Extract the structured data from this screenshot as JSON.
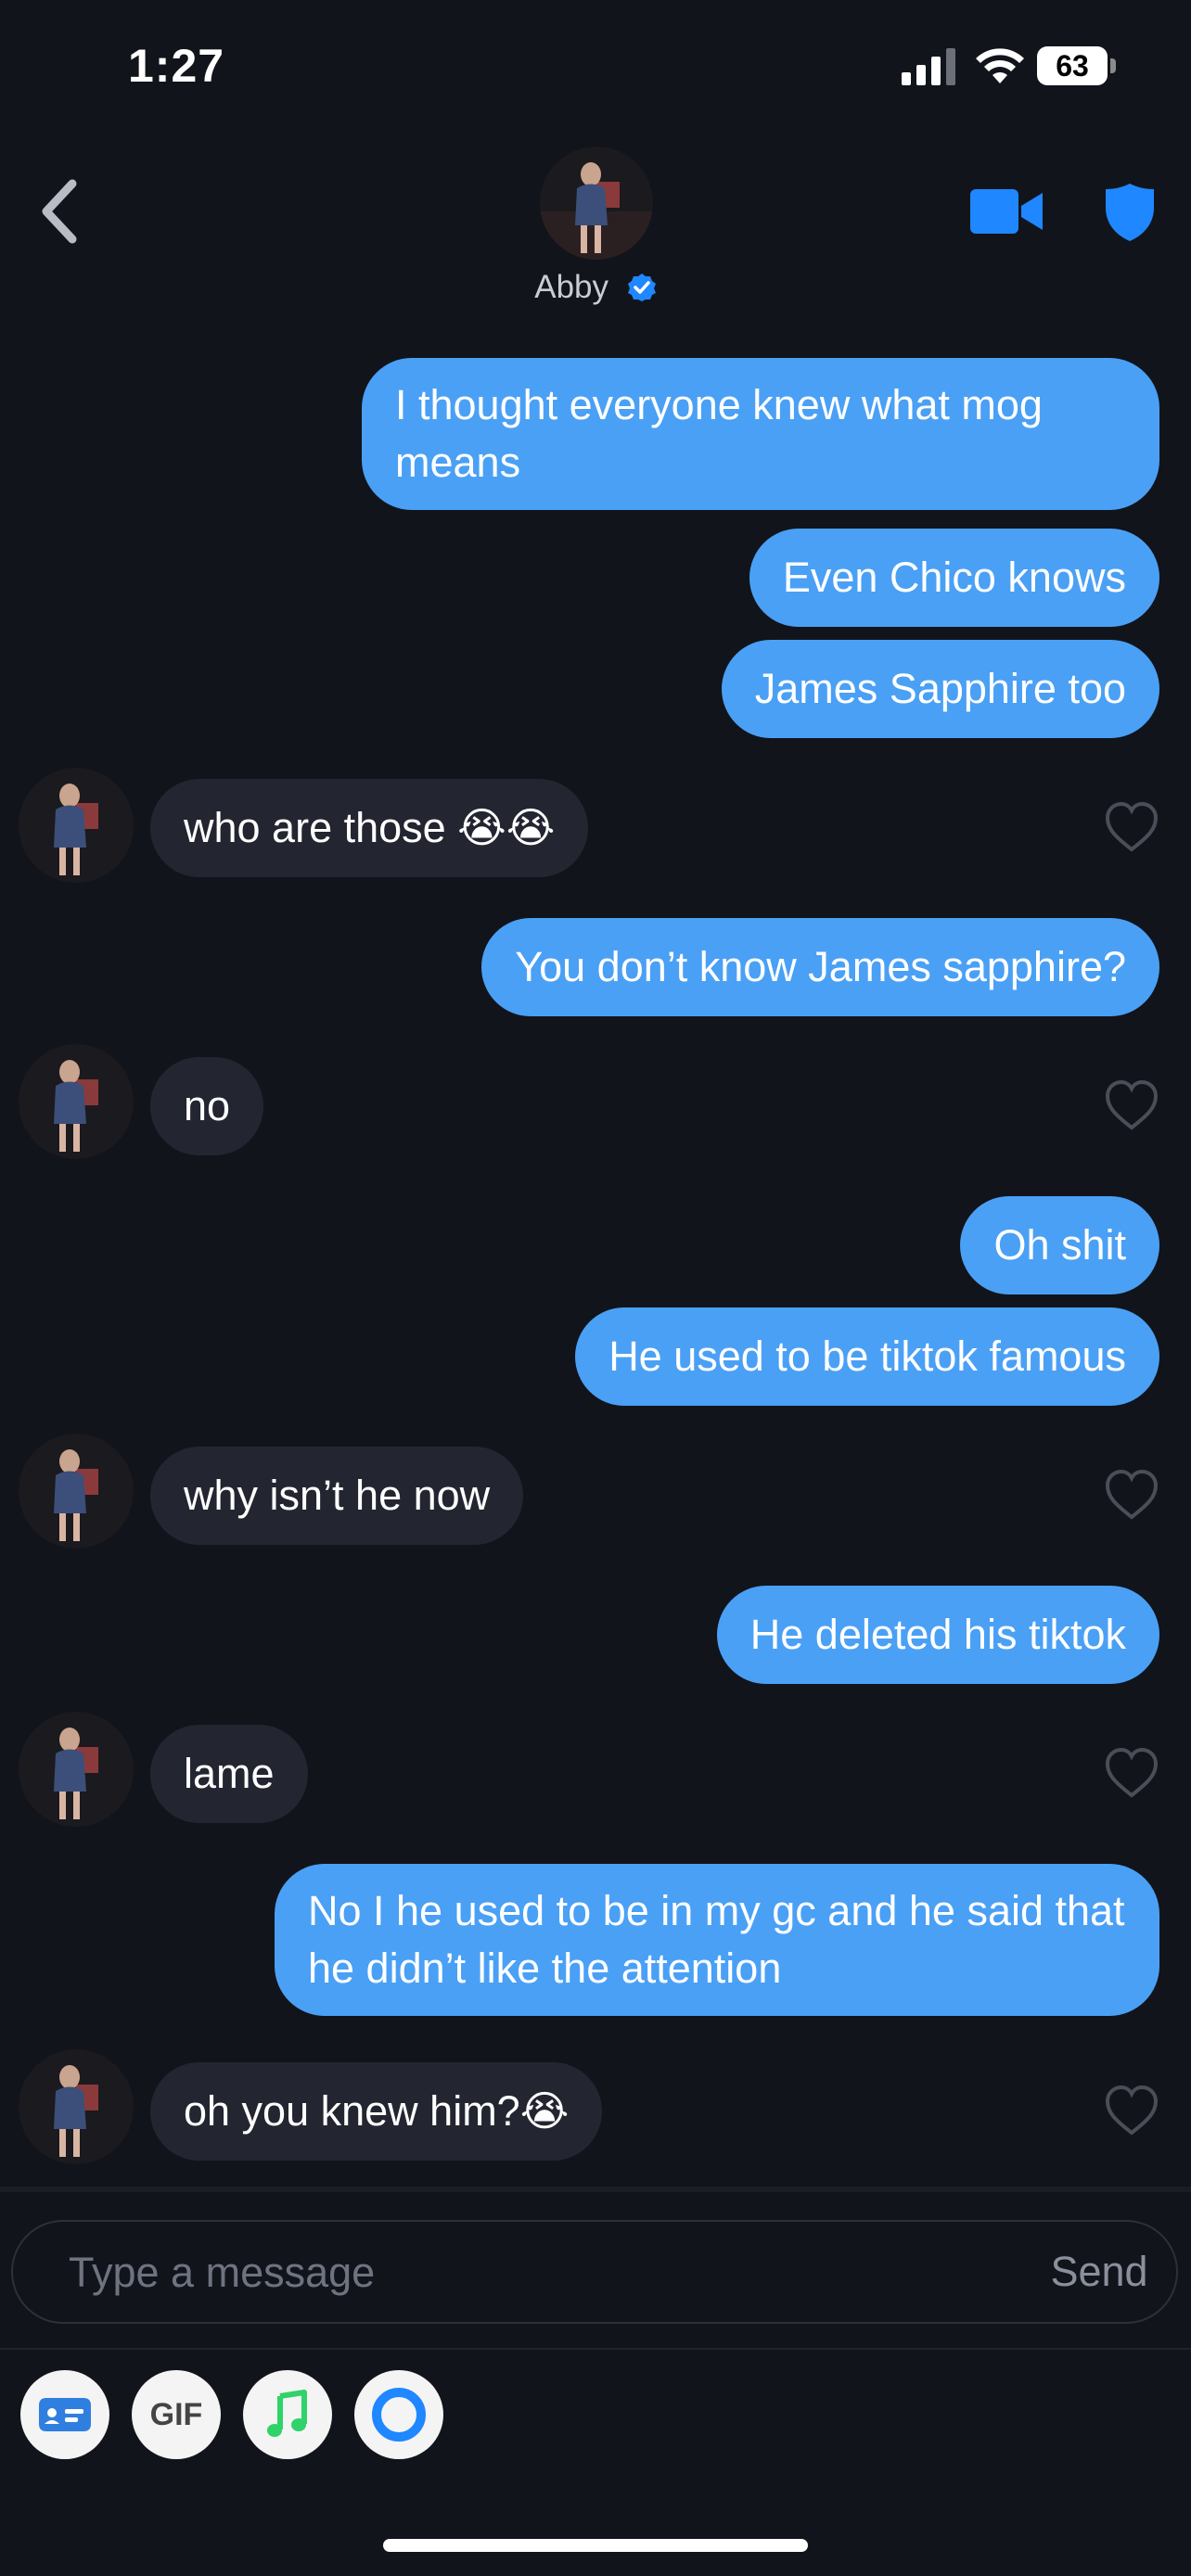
{
  "status_bar": {
    "time": "1:27",
    "battery": "63",
    "battery_level": 0.63
  },
  "header": {
    "contact_name": "Abby"
  },
  "messages": [
    {
      "from": "me",
      "text": "I thought everyone knew what mog means"
    },
    {
      "from": "me",
      "text": "Even Chico knows"
    },
    {
      "from": "me",
      "text": "James Sapphire too"
    },
    {
      "from": "them",
      "text": "who are those 😭😭"
    },
    {
      "from": "me",
      "text": "You don’t know James sapphire?"
    },
    {
      "from": "them",
      "text": "no"
    },
    {
      "from": "me",
      "text": "Oh shit"
    },
    {
      "from": "me",
      "text": "He used to be tiktok famous"
    },
    {
      "from": "them",
      "text": "why isn’t he now"
    },
    {
      "from": "me",
      "text": "He deleted his tiktok"
    },
    {
      "from": "them",
      "text": "lame"
    },
    {
      "from": "me",
      "text": "No I he used to be in my gc and he said that he didn’t like the attention"
    },
    {
      "from": "them",
      "text": "oh you knew him?😭"
    }
  ],
  "composer": {
    "placeholder": "Type a message",
    "send_label": "Send"
  },
  "toolbar": {
    "gif_label": "GIF",
    "icons": [
      "sticker-card-icon",
      "gif-icon",
      "music-icon",
      "ring-icon"
    ]
  },
  "colors": {
    "sent_bubble": "#4aa0f5",
    "received_bubble": "#232630",
    "background": "#11141b",
    "accent": "#1f87ff"
  }
}
